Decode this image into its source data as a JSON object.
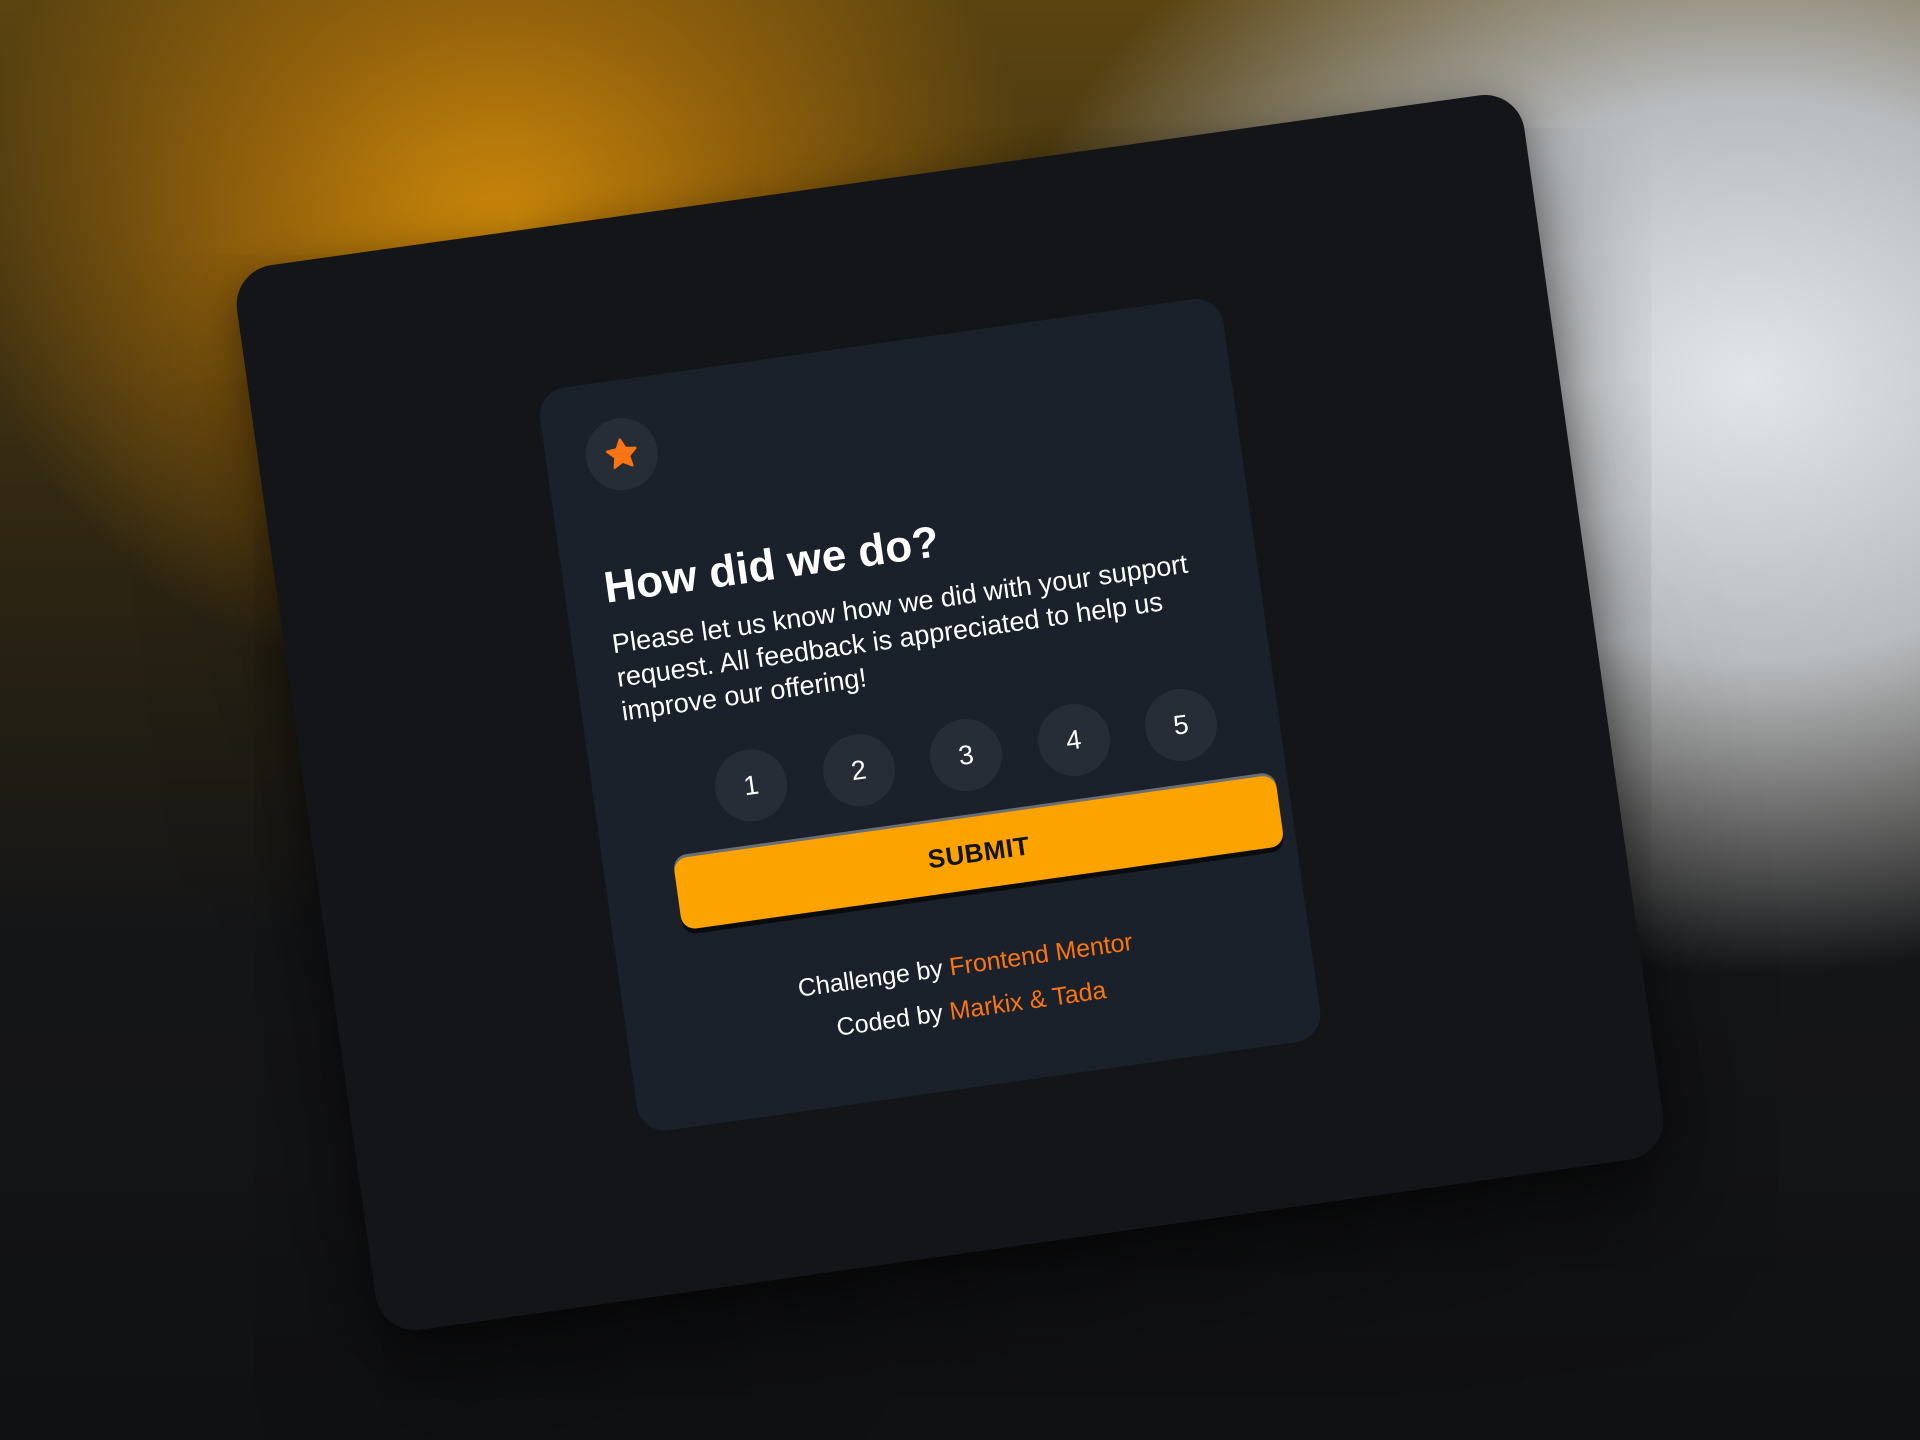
{
  "card": {
    "icon": "star-icon",
    "title": "How did we do?",
    "description": "Please let us know how we did with your support request. All feedback is appreciated to help us improve our offering!",
    "ratings": [
      "1",
      "2",
      "3",
      "4",
      "5"
    ],
    "submit_label": "SUBMIT"
  },
  "attribution": {
    "challenge_prefix": "Challenge by",
    "challenge_link": "Frontend Mentor",
    "coded_prefix": "Coded by",
    "coded_link": "Markix & Tada"
  },
  "colors": {
    "accent_orange": "#fb7413",
    "button_orange": "#fca300",
    "card_bg": "#1b212a",
    "frame_bg": "#131519",
    "circle_bg": "#262d37"
  }
}
